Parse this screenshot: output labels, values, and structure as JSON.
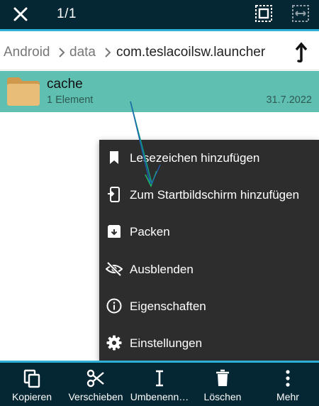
{
  "toolbar": {
    "selection_count": "1/1",
    "close_icon": "close-icon",
    "select_all_icon": "select-all-icon",
    "select_range_icon": "select-range-icon"
  },
  "breadcrumb": {
    "items": [
      "Android",
      "data",
      "com.teslacoilsw.launcher"
    ],
    "up_icon": "navigate-up-icon"
  },
  "file_list": {
    "items": [
      {
        "name": "cache",
        "details": "1 Element",
        "date": "31.7.2022",
        "icon": "folder-icon",
        "selected": true
      }
    ]
  },
  "context_menu": {
    "items": [
      {
        "label": "Lesezeichen hinzufügen",
        "icon": "bookmark-icon"
      },
      {
        "label": "Zum Startbildschirm hinzufügen",
        "icon": "add-to-home-icon"
      },
      {
        "label": "Packen",
        "icon": "archive-icon"
      },
      {
        "label": "Ausblenden",
        "icon": "eye-off-icon"
      },
      {
        "label": "Eigenschaften",
        "icon": "info-icon"
      },
      {
        "label": "Einstellungen",
        "icon": "gear-icon"
      }
    ]
  },
  "bottom_bar": {
    "items": [
      {
        "label": "Kopieren",
        "icon": "copy-icon"
      },
      {
        "label": "Verschieben",
        "icon": "scissors-icon"
      },
      {
        "label": "Umbenenn…",
        "icon": "rename-icon"
      },
      {
        "label": "Löschen",
        "icon": "trash-icon"
      },
      {
        "label": "Mehr",
        "icon": "more-vertical-icon"
      }
    ]
  },
  "colors": {
    "toolbar_bg": "#052633",
    "accent": "#2fb0d8",
    "selected_row": "#5fbfb1",
    "folder": "#e3b56e",
    "menu_bg": "#2d2d2d"
  }
}
